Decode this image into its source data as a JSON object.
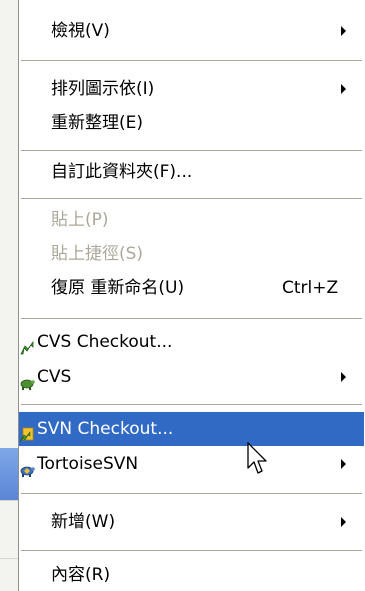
{
  "context_menu": {
    "items": [
      {
        "label": "檢視(V)",
        "has_submenu": true
      },
      {
        "label": "排列圖示依(I)",
        "has_submenu": true
      },
      {
        "label": "重新整理(E)"
      },
      {
        "label": "自訂此資料夾(F)..."
      },
      {
        "label": "貼上(P)",
        "disabled": true
      },
      {
        "label": "貼上捷徑(S)",
        "disabled": true
      },
      {
        "label": "復原 重新命名(U)",
        "shortcut": "Ctrl+Z"
      },
      {
        "label": "CVS Checkout...",
        "icon": "cvs-checkout-icon"
      },
      {
        "label": "CVS",
        "icon": "tortoise-cvs-icon",
        "has_submenu": true
      },
      {
        "label": "SVN Checkout...",
        "icon": "svn-checkout-icon",
        "selected": true
      },
      {
        "label": "TortoiseSVN",
        "icon": "tortoise-svn-icon",
        "has_submenu": true
      },
      {
        "label": "新增(W)",
        "has_submenu": true
      },
      {
        "label": "內容(R)"
      }
    ]
  },
  "colors": {
    "selection": "#316ac5",
    "disabled_text": "#aca899",
    "separator": "#aca899"
  }
}
